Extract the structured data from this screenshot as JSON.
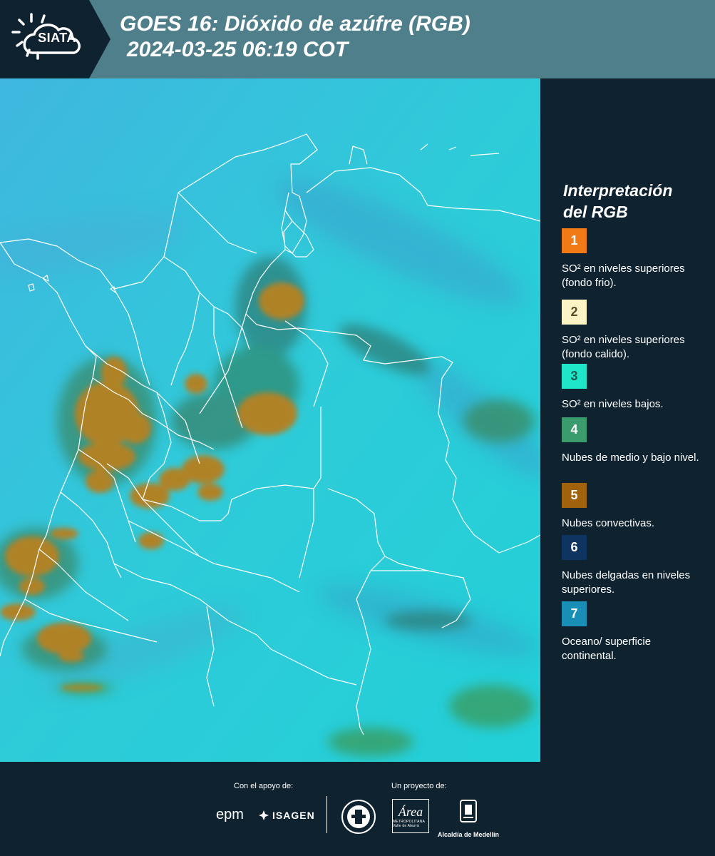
{
  "header": {
    "logo_text": "SIATA",
    "title_line1": "GOES 16: Dióxido de azúfre (RGB)",
    "title_line2": "2024-03-25 06:19 COT"
  },
  "legend": {
    "title_line1": "Interpretación",
    "title_line2": "del RGB",
    "items": [
      {
        "number": "1",
        "color": "#f27a16",
        "text_color": "#ffffff",
        "label": "SO² en niveles superiores (fondo frio)."
      },
      {
        "number": "2",
        "color": "#fcf4c4",
        "text_color": "#5a4a2a",
        "label": "SO² en niveles superiores (fondo calido)."
      },
      {
        "number": "3",
        "color": "#1fe6c8",
        "text_color": "#1a5a50",
        "label": "SO² en niveles bajos."
      },
      {
        "number": "4",
        "color": "#3a9c6c",
        "text_color": "#ffffff",
        "label": "Nubes de medio y bajo nivel."
      },
      {
        "number": "5",
        "color": "#a0620d",
        "text_color": "#ffffff",
        "label": "Nubes convectivas."
      },
      {
        "number": "6",
        "color": "#0e3460",
        "text_color": "#ffffff",
        "label": "Nubes delgadas en niveles superiores."
      },
      {
        "number": "7",
        "color": "#1a8fb6",
        "text_color": "#ffffff",
        "label": "Oceano/ superficie continental."
      }
    ]
  },
  "footer": {
    "support_label": "Con el apoyo de:",
    "project_label": "Un proyecto de:",
    "sponsors": [
      "epm",
      "ISAGEN"
    ],
    "area_logo_text": "Área",
    "area_logo_sub": "METROPOLITANA Valle de Aburrá",
    "medellin_text": "Alcaldía de Medellín"
  },
  "colors": {
    "background": "#0f2230",
    "header": "#4f7f8b",
    "map_base": "#27c9d8",
    "convective": "#a8761a",
    "mid_cloud": "#2f8a7a",
    "border_lines": "#ffffff"
  }
}
